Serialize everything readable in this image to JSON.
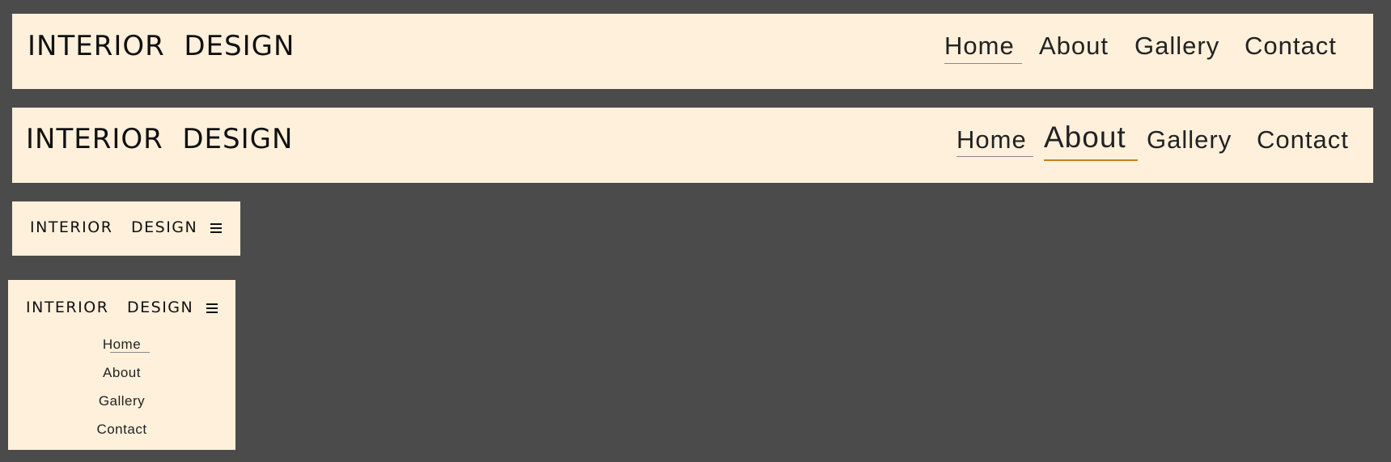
{
  "variants": [
    {
      "logo": "INTERIOR  DESIGN",
      "nav": [
        {
          "label": "Home",
          "active": true
        },
        {
          "label": "About",
          "active": false
        },
        {
          "label": "Gallery",
          "active": false
        },
        {
          "label": "Contact",
          "active": false
        }
      ]
    },
    {
      "logo": "INTERIOR  DESIGN",
      "nav": [
        {
          "label": "Home",
          "active": true
        },
        {
          "label": "About",
          "hovered": true
        },
        {
          "label": "Gallery",
          "active": false
        },
        {
          "label": "Contact",
          "active": false
        }
      ]
    },
    {
      "logo": "INTERIOR   DESIGN",
      "menu_icon": "hamburger-menu-icon",
      "menu_open": false
    },
    {
      "logo": "INTERIOR   DESIGN",
      "menu_icon": "hamburger-menu-icon",
      "menu_open": true,
      "nav": [
        {
          "label": "Home",
          "active": true
        },
        {
          "label": "About",
          "active": false
        },
        {
          "label": "Gallery",
          "active": false
        },
        {
          "label": "Contact",
          "active": false
        }
      ]
    }
  ],
  "colors": {
    "page_background": "#4b4b4b",
    "navbar_background": "#fff0db",
    "text": "#111111",
    "active_underline": "#8a8a8a",
    "hover_underline": "#c7801e"
  }
}
